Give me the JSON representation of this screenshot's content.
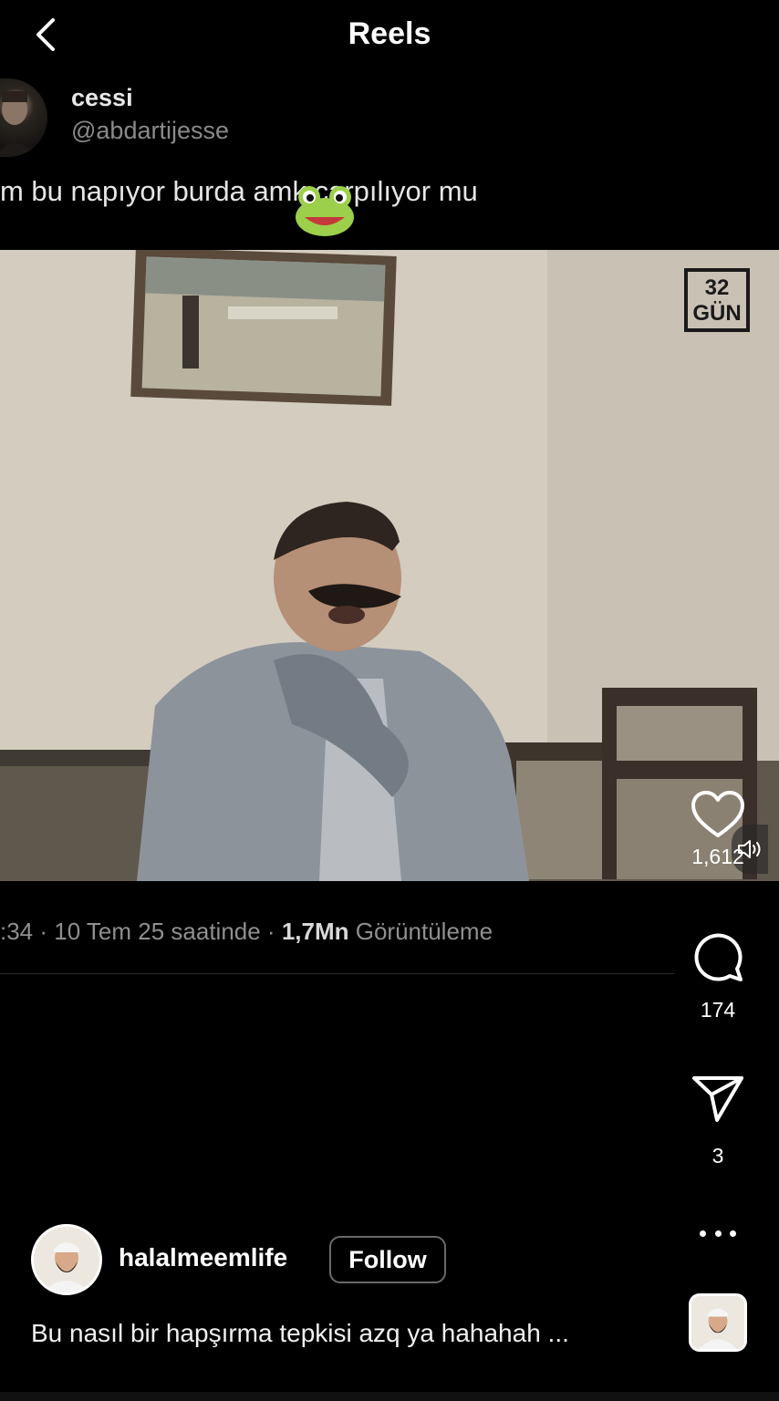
{
  "header": {
    "title": "Reels",
    "back_icon": "chevron-left-icon"
  },
  "tweet": {
    "display_name": "cessi",
    "handle": "@abdartijesse",
    "text": "m bu napıyor burda amk çarpılıyor mu",
    "emoji": "frog-icon"
  },
  "video": {
    "watermark": "32\nGÜN",
    "watermark_line1": "32",
    "watermark_line2": "GÜN"
  },
  "post_meta": {
    "time_part": ":34 · 10 Tem 25 saatinde · ",
    "views": "1,7Mn",
    "views_label": " Görüntüleme"
  },
  "actions": {
    "like_count": "1,612",
    "comment_count": "174",
    "share_count": "3"
  },
  "author": {
    "username": "halalmeemlife",
    "follow_label": "Follow"
  },
  "caption": "Bu nasıl bir hapşırma tepkisi azq ya hahahah ...",
  "colors": {
    "background": "#000000",
    "text": "#ffffff",
    "muted": "#8f8f8f"
  }
}
